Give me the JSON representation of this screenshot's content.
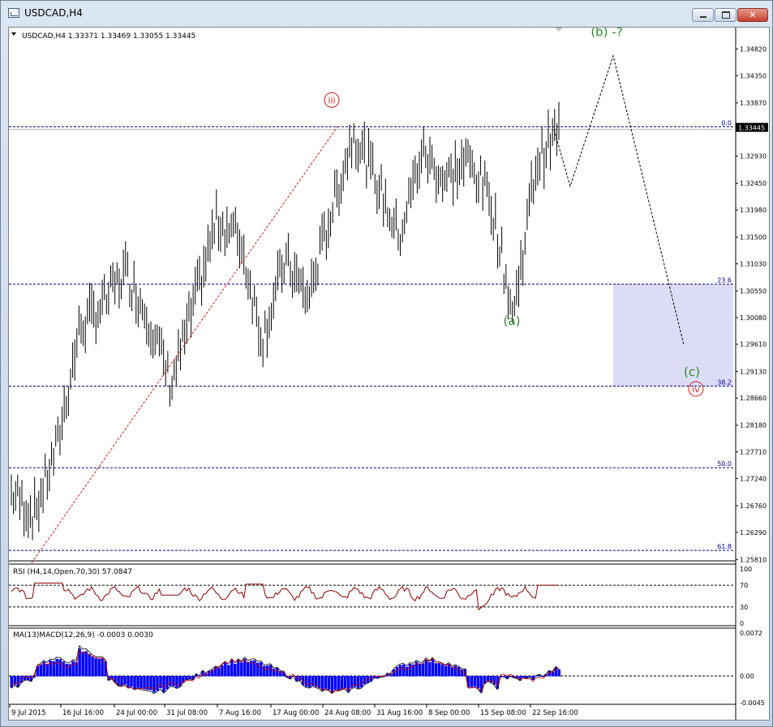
{
  "window": {
    "title": "USDCAD,H4",
    "minimize": "",
    "maximize": "",
    "close": "✕"
  },
  "colors": {
    "bull_wave": "#2e8b2e",
    "bear_wave": "#cc2222",
    "fib": "#00008b",
    "box": "#dcdcf7",
    "bars": "#000000",
    "histogram": "#0000ff",
    "signal": "#cc0000"
  },
  "chart_data": {
    "type": "line",
    "header": "USDCAD,H4  1.33371 1.33469 1.33055 1.33445",
    "price_axis": {
      "ticks": [
        "1.34820",
        "1.34350",
        "1.33870",
        "1.33445",
        "1.32930",
        "1.32450",
        "1.31980",
        "1.31500",
        "1.31030",
        "1.30550",
        "1.30080",
        "1.29610",
        "1.29130",
        "1.28660",
        "1.28180",
        "1.27710",
        "1.27240",
        "1.26760",
        "1.26290",
        "1.25810"
      ],
      "ylim": [
        1.258,
        1.352
      ],
      "current_price": "1.33445"
    },
    "time_axis": {
      "ticks": [
        "9 Jul 2015",
        "16 Jul 16:00",
        "24 Jul 00:00",
        "31 Jul 08:00",
        "7 Aug 16:00",
        "17 Aug 00:00",
        "24 Aug 08:00",
        "31 Aug 16:00",
        "8 Sep 00:00",
        "15 Sep 08:00",
        "22 Sep 16:00"
      ]
    },
    "price_path": {
      "x": [
        0,
        1,
        2,
        3,
        4,
        5,
        6,
        7,
        8,
        9,
        10,
        11,
        12,
        13,
        14,
        15,
        16,
        17,
        18,
        19,
        20,
        21,
        22,
        23,
        24
      ],
      "y": [
        1.27,
        1.266,
        1.278,
        1.299,
        1.303,
        1.309,
        1.301,
        1.289,
        1.303,
        1.318,
        1.315,
        1.297,
        1.311,
        1.304,
        1.319,
        1.3335,
        1.325,
        1.315,
        1.33,
        1.325,
        1.3285,
        1.322,
        1.301,
        1.328,
        1.334
      ]
    },
    "fib_levels": [
      {
        "label": "0.0",
        "value": 1.3345
      },
      {
        "label": "23.6",
        "value": 1.3067
      },
      {
        "label": "38.2",
        "value": 1.2887
      },
      {
        "label": "50.0",
        "value": 1.2743
      },
      {
        "label": "61.8",
        "value": 1.2597
      }
    ],
    "wave_labels": [
      {
        "text": "iii",
        "price": 1.3385
      },
      {
        "text": "(a)",
        "price": 1.2995
      },
      {
        "text": "(b) -?",
        "price": 1.3505
      },
      {
        "text": "(c)",
        "price": 1.2905
      },
      {
        "text": "iv",
        "price": 1.2875
      }
    ],
    "projection": {
      "price": [
        1.334,
        1.324,
        1.347,
        1.296
      ]
    },
    "rsi": {
      "label": "RSI (H4,14,Open,70,30) 57.0847",
      "ticks": [
        "100",
        "70",
        "30",
        "0"
      ]
    },
    "macd": {
      "label": "MA(13)MACD(12,26,9) -0.0003 0.0030",
      "ticks": [
        "0.0072",
        "0.00",
        "-0.0045"
      ]
    }
  }
}
